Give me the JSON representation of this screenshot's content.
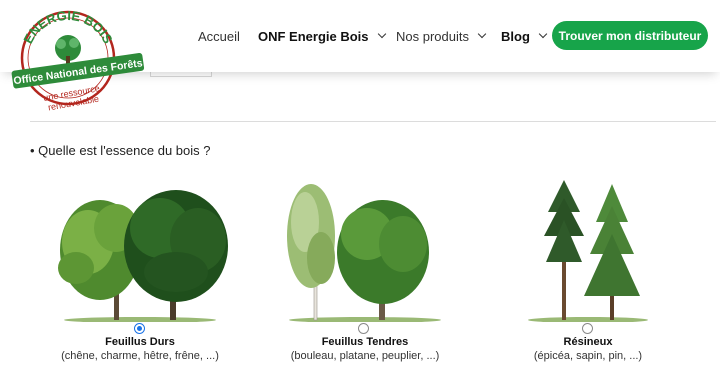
{
  "logo": {
    "top_text": "ENERGIE BOIS",
    "band_text": "Office National des Forêts",
    "bottom_text_1": "une ressource",
    "bottom_text_2": "renouvelable",
    "colors": {
      "red": "#b3261e",
      "green": "#2e8b3a"
    }
  },
  "nav": {
    "items": [
      {
        "label": "Accueil",
        "has_dropdown": false
      },
      {
        "label": "ONF Energie Bois",
        "has_dropdown": true
      },
      {
        "label": "Nos produits",
        "has_dropdown": true
      },
      {
        "label": "Blog",
        "has_dropdown": true
      }
    ],
    "cta_label": "Trouver mon distributeur",
    "cta_color": "#17a44a"
  },
  "question": "• Quelle est l'essence du bois ?",
  "options": [
    {
      "title": "Feuillus Durs",
      "subtitle": "(chêne, charme, hêtre, frêne, ...)",
      "selected": true,
      "icon": "hardwood-trees-icon"
    },
    {
      "title": "Feuillus Tendres",
      "subtitle": "(bouleau, platane, peuplier, ...)",
      "selected": false,
      "icon": "softwood-trees-icon"
    },
    {
      "title": "Résineux",
      "subtitle": "(épicéa, sapin, pin, ...)",
      "selected": false,
      "icon": "conifer-trees-icon"
    }
  ]
}
